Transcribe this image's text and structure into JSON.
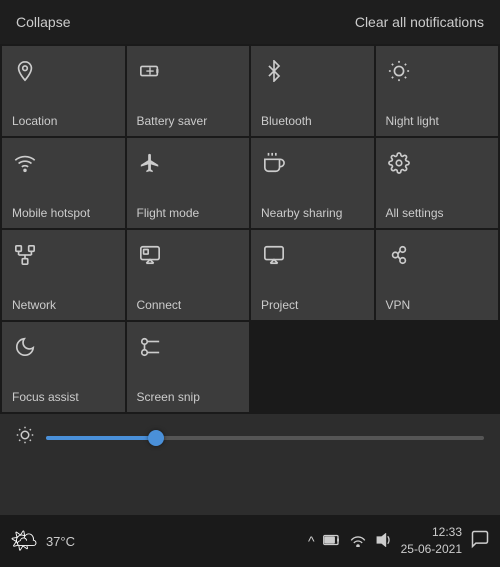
{
  "header": {
    "collapse_label": "Collapse",
    "clear_label": "Clear all notifications"
  },
  "tiles": [
    {
      "id": "location",
      "label": "Location",
      "icon": "📍",
      "unicode": "loc",
      "active": false
    },
    {
      "id": "battery-saver",
      "label": "Battery saver",
      "icon": "🔋",
      "unicode": "bat",
      "active": false
    },
    {
      "id": "bluetooth",
      "label": "Bluetooth",
      "icon": "✱",
      "unicode": "bt",
      "active": false
    },
    {
      "id": "night-light",
      "label": "Night light",
      "icon": "☀",
      "unicode": "nl",
      "active": false
    },
    {
      "id": "mobile-hotspot",
      "label": "Mobile hotspot",
      "icon": "📶",
      "unicode": "mh",
      "active": false
    },
    {
      "id": "flight-mode",
      "label": "Flight mode",
      "icon": "✈",
      "unicode": "fm",
      "active": false
    },
    {
      "id": "nearby-sharing",
      "label": "Nearby sharing",
      "icon": "⇆",
      "unicode": "ns",
      "active": false
    },
    {
      "id": "all-settings",
      "label": "All settings",
      "icon": "⚙",
      "unicode": "as",
      "active": false
    },
    {
      "id": "network",
      "label": "Network",
      "icon": "📡",
      "unicode": "nw",
      "active": false
    },
    {
      "id": "connect",
      "label": "Connect",
      "icon": "📺",
      "unicode": "cn",
      "active": false
    },
    {
      "id": "project",
      "label": "Project",
      "icon": "🖥",
      "unicode": "pj",
      "active": false
    },
    {
      "id": "vpn",
      "label": "VPN",
      "icon": "🔀",
      "unicode": "vp",
      "active": false
    },
    {
      "id": "focus-assist",
      "label": "Focus assist",
      "icon": "🌙",
      "unicode": "fa",
      "active": false
    },
    {
      "id": "screen-snip",
      "label": "Screen snip",
      "icon": "✂",
      "unicode": "ss",
      "active": false
    }
  ],
  "brightness": {
    "value": 25,
    "sun_icon": "☀"
  },
  "taskbar": {
    "weather_emoji": "🌤",
    "temperature": "37°C",
    "time": "12:33",
    "date": "25-06-2021",
    "chevron": "^",
    "chat_icon": "💬"
  }
}
